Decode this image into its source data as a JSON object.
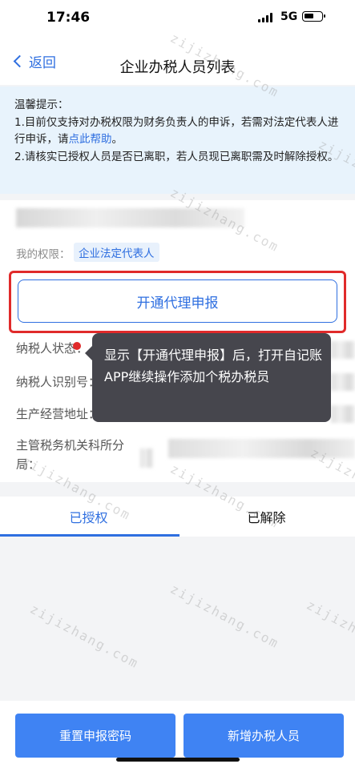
{
  "status_bar": {
    "time": "17:46",
    "network": "5G"
  },
  "nav": {
    "back_label": "返回",
    "title": "企业办税人员列表"
  },
  "notice": {
    "title": "温馨提示：",
    "line1_prefix": "1.目前仅支持对办税权限为财务负责人的申诉，若需对法定代表人进行申诉，请",
    "line1_link": "点此帮助",
    "line1_suffix": "。",
    "line2": "2.请核实已授权人员是否已离职，若人员现已离职需及时解除授权。"
  },
  "taxpayer": {
    "permission_label": "我的权限：",
    "permission_tag": "企业法定代表人",
    "open_agent_button": "开通代理申报",
    "rows": [
      {
        "label": "纳税人状态："
      },
      {
        "label": "纳税人识别号："
      },
      {
        "label": "生产经营地址："
      },
      {
        "label": "主管税务机关科所分局："
      }
    ]
  },
  "tooltip": {
    "text": "显示【开通代理申报】后，打开自记账APP继续操作添加个税办税员"
  },
  "tabs": [
    {
      "label": "已授权",
      "active": true
    },
    {
      "label": "已解除",
      "active": false
    }
  ],
  "watermark": "zijizhang.com",
  "buttons": {
    "reset_password": "重置申报密码",
    "add_tax_staff": "新增办税人员"
  },
  "colors": {
    "accent": "#2f6fe0",
    "button": "#3f83f3",
    "highlight": "#e02a2a",
    "notice_bg": "#e8f3fc"
  }
}
